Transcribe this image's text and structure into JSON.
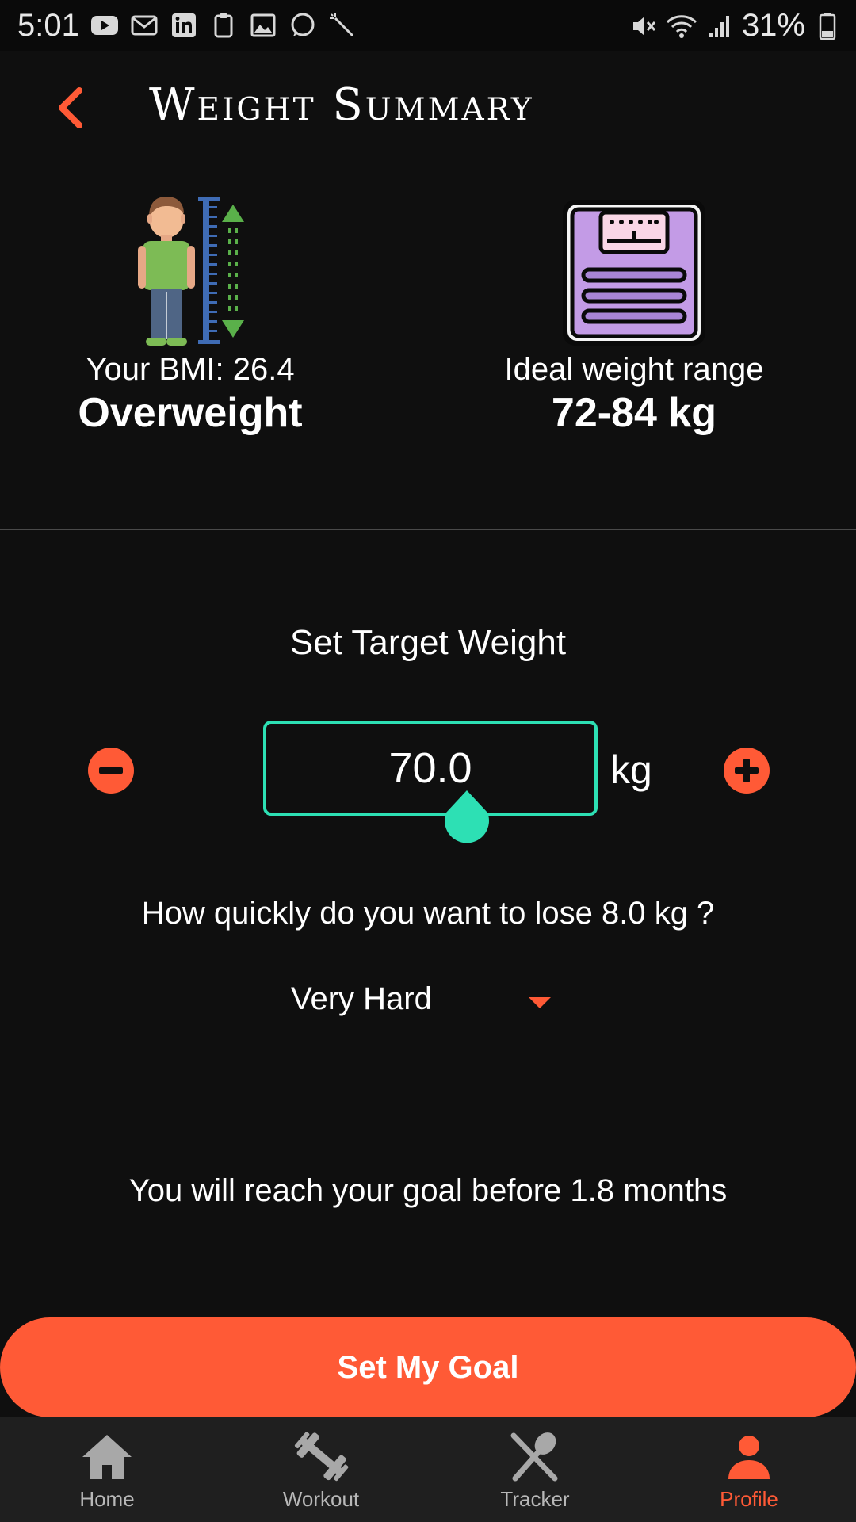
{
  "status_bar": {
    "time": "5:01",
    "battery": "31%"
  },
  "header": {
    "title": "Weight Summary"
  },
  "summary": {
    "bmi_label": "Your BMI: 26.4",
    "bmi_category": "Overweight",
    "ideal_label": "Ideal weight range",
    "ideal_range": "72-84 kg"
  },
  "target": {
    "title": "Set Target Weight",
    "value": "70.0",
    "unit": "kg"
  },
  "pace": {
    "question": "How quickly do you want to lose 8.0 kg ?",
    "selected": "Very Hard"
  },
  "result": {
    "text": "You will reach your goal before 1.8 months"
  },
  "actions": {
    "goal_button": "Set My Goal"
  },
  "nav": {
    "items": [
      {
        "label": "Home",
        "icon": "home-icon"
      },
      {
        "label": "Workout",
        "icon": "dumbbell-icon"
      },
      {
        "label": "Tracker",
        "icon": "utensils-icon"
      },
      {
        "label": "Profile",
        "icon": "person-icon"
      }
    ],
    "active": "Profile"
  },
  "colors": {
    "accent": "#ff5a36",
    "teal": "#2de0b4",
    "background": "#0f0f0f"
  }
}
